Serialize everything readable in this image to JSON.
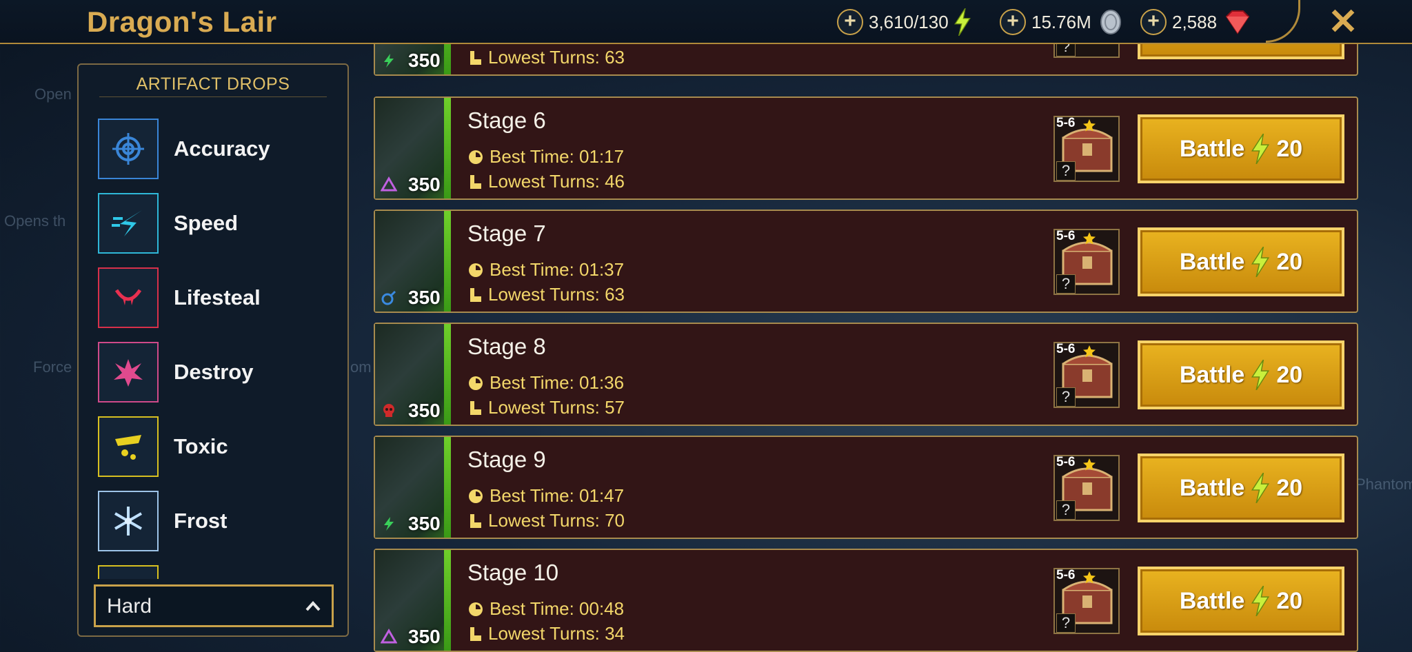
{
  "header": {
    "title": "Dragon's Lair",
    "energy": "3,610/130",
    "silver": "15.76M",
    "gems": "2,588"
  },
  "background_labels": [
    "Open",
    "Opens th",
    "Force",
    "om",
    "Phantom"
  ],
  "artifact_panel": {
    "title": "ARTIFACT DROPS",
    "items": [
      {
        "label": "Accuracy",
        "icon": "accuracy-icon",
        "color": "#3a86d8"
      },
      {
        "label": "Speed",
        "icon": "speed-icon",
        "color": "#2fb8d8"
      },
      {
        "label": "Lifesteal",
        "icon": "lifesteal-icon",
        "color": "#d8304a"
      },
      {
        "label": "Destroy",
        "icon": "destroy-icon",
        "color": "#d04a8a"
      },
      {
        "label": "Toxic",
        "icon": "toxic-icon",
        "color": "#d8c020"
      },
      {
        "label": "Frost",
        "icon": "frost-icon",
        "color": "#9ec4e8"
      }
    ],
    "difficulty": "Hard"
  },
  "stages": [
    {
      "name": "",
      "level": "350",
      "affinity": "spirit",
      "best_time": "",
      "lowest_turns": "Lowest Turns: 63"
    },
    {
      "name": "Stage 6",
      "level": "350",
      "affinity": "magic",
      "best_time": "Best Time: 01:17",
      "lowest_turns": "Lowest Turns: 46",
      "rank": "5-6",
      "battle_label": "Battle",
      "battle_cost": "20"
    },
    {
      "name": "Stage 7",
      "level": "350",
      "affinity": "force",
      "best_time": "Best Time: 01:37",
      "lowest_turns": "Lowest Turns: 63",
      "rank": "5-6",
      "battle_label": "Battle",
      "battle_cost": "20"
    },
    {
      "name": "Stage 8",
      "level": "350",
      "affinity": "void",
      "best_time": "Best Time: 01:36",
      "lowest_turns": "Lowest Turns: 57",
      "rank": "5-6",
      "battle_label": "Battle",
      "battle_cost": "20"
    },
    {
      "name": "Stage 9",
      "level": "350",
      "affinity": "spirit",
      "best_time": "Best Time: 01:47",
      "lowest_turns": "Lowest Turns: 70",
      "rank": "5-6",
      "battle_label": "Battle",
      "battle_cost": "20"
    },
    {
      "name": "Stage 10",
      "level": "350",
      "affinity": "magic",
      "best_time": "Best Time: 00:48",
      "lowest_turns": "Lowest Turns: 34",
      "rank": "5-6",
      "battle_label": "Battle",
      "battle_cost": "20"
    }
  ],
  "chest_unknown": "?",
  "colors": {
    "gold": "#d9ab52",
    "row_bg": "#321516",
    "battle": "#e0a518",
    "stat_text": "#f3d76a"
  }
}
